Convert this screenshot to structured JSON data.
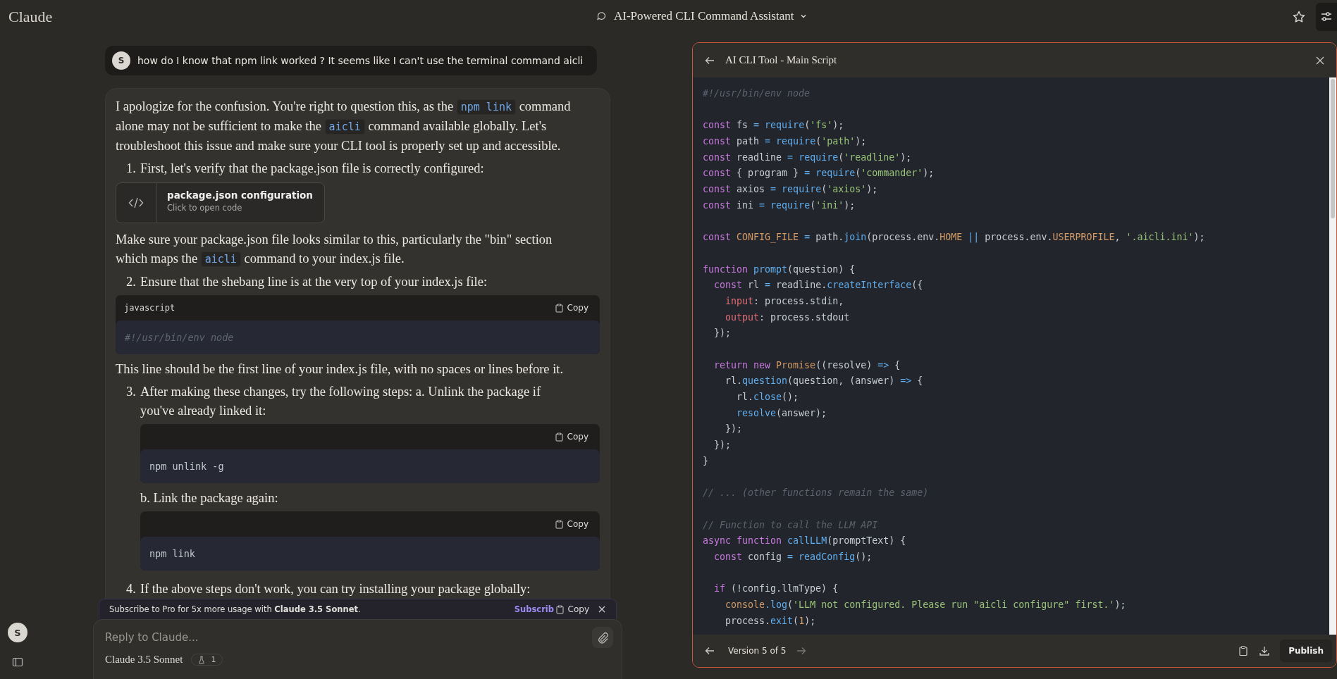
{
  "app": {
    "logo": "Claude",
    "chat_title": "AI-Powered CLI Command Assistant"
  },
  "user_message": {
    "avatar": "S",
    "text": "how do I know that npm link worked ? It seems like I can't use the terminal command aicli"
  },
  "assistant_blocks": [
    {
      "kind": "paragraph",
      "segments": [
        {
          "text": "I apologize for the confusion. You're right to question this, as the "
        },
        {
          "code": "npm link"
        },
        {
          "text": " command alone may not be sufficient to make the "
        },
        {
          "code": "aicli"
        },
        {
          "text": " command available globally. Let's troubleshoot this issue and make sure your CLI tool is properly set up and accessible."
        }
      ]
    },
    {
      "kind": "list_item",
      "number": "1.",
      "text": "First, let's verify that the package.json file is correctly configured:"
    },
    {
      "kind": "artifact_card",
      "title": "package.json configuration",
      "subtitle": "Click to open code"
    },
    {
      "kind": "paragraph",
      "segments": [
        {
          "text": "Make sure your package.json file looks similar to this, particularly the \"bin\" section which maps the "
        },
        {
          "code": "aicli"
        },
        {
          "text": " command to your index.js file."
        }
      ]
    },
    {
      "kind": "list_item",
      "number": "2.",
      "text": "Ensure that the shebang line is at the very top of your index.js file:"
    },
    {
      "kind": "code_block",
      "language": "javascript",
      "copy_label": "Copy",
      "code": "#!/usr/bin/env node",
      "comment": true
    },
    {
      "kind": "paragraph",
      "segments": [
        {
          "text": "This line should be the first line of your index.js file, with no spaces or lines before it."
        }
      ]
    },
    {
      "kind": "list_item",
      "number": "3.",
      "text": "After making these changes, try the following steps: a. Unlink the package if you've already linked it:",
      "children": [
        {
          "kind": "code_block",
          "copy_label": "Copy",
          "code": "npm unlink -g",
          "comment": false
        },
        {
          "kind": "paragraph",
          "segments": [
            {
              "text": "b. Link the package again:"
            }
          ]
        },
        {
          "kind": "code_block",
          "copy_label": "Copy",
          "code": "npm link",
          "comment": false
        }
      ]
    },
    {
      "kind": "list_item",
      "number": "4.",
      "text": "If the above steps don't work, you can try installing your package globally:"
    }
  ],
  "banner": {
    "text": "Subscribe to Pro for 5x more usage with **Claude 3.5 Sonnet**.",
    "link": "Subscrib",
    "overlay_copy": "Copy"
  },
  "composer": {
    "placeholder": "Reply to Claude...",
    "model": "Claude 3.5 Sonnet",
    "badge": "1"
  },
  "rail": {
    "avatar": "S"
  },
  "artifact": {
    "title": "AI CLI Tool - Main Script",
    "version": "Version 5 of 5",
    "publish": "Publish",
    "lines": [
      {
        "kind": "code",
        "tokens": [
          {
            "kind": "cm",
            "t": "#!/usr/bin/env node"
          }
        ]
      },
      {
        "kind": "blank"
      },
      {
        "kind": "code",
        "tokens": [
          {
            "kind": "kw",
            "t": "const "
          },
          {
            "kind": "pl",
            "t": "fs "
          },
          {
            "kind": "op",
            "t": "= "
          },
          {
            "kind": "fn",
            "t": "require"
          },
          {
            "kind": "pl",
            "t": "("
          },
          {
            "kind": "st",
            "t": "'fs'"
          },
          {
            "kind": "pl",
            "t": ");"
          }
        ]
      },
      {
        "kind": "code",
        "tokens": [
          {
            "kind": "kw",
            "t": "const "
          },
          {
            "kind": "pl",
            "t": "path "
          },
          {
            "kind": "op",
            "t": "= "
          },
          {
            "kind": "fn",
            "t": "require"
          },
          {
            "kind": "pl",
            "t": "("
          },
          {
            "kind": "st",
            "t": "'path'"
          },
          {
            "kind": "pl",
            "t": ");"
          }
        ]
      },
      {
        "kind": "code",
        "tokens": [
          {
            "kind": "kw",
            "t": "const "
          },
          {
            "kind": "pl",
            "t": "readline "
          },
          {
            "kind": "op",
            "t": "= "
          },
          {
            "kind": "fn",
            "t": "require"
          },
          {
            "kind": "pl",
            "t": "("
          },
          {
            "kind": "st",
            "t": "'readline'"
          },
          {
            "kind": "pl",
            "t": ");"
          }
        ]
      },
      {
        "kind": "code",
        "tokens": [
          {
            "kind": "kw",
            "t": "const "
          },
          {
            "kind": "pl",
            "t": "{ program } "
          },
          {
            "kind": "op",
            "t": "= "
          },
          {
            "kind": "fn",
            "t": "require"
          },
          {
            "kind": "pl",
            "t": "("
          },
          {
            "kind": "st",
            "t": "'commander'"
          },
          {
            "kind": "pl",
            "t": ");"
          }
        ]
      },
      {
        "kind": "code",
        "tokens": [
          {
            "kind": "kw",
            "t": "const "
          },
          {
            "kind": "pl",
            "t": "axios "
          },
          {
            "kind": "op",
            "t": "= "
          },
          {
            "kind": "fn",
            "t": "require"
          },
          {
            "kind": "pl",
            "t": "("
          },
          {
            "kind": "st",
            "t": "'axios'"
          },
          {
            "kind": "pl",
            "t": ");"
          }
        ]
      },
      {
        "kind": "code",
        "tokens": [
          {
            "kind": "kw",
            "t": "const "
          },
          {
            "kind": "pl",
            "t": "ini "
          },
          {
            "kind": "op",
            "t": "= "
          },
          {
            "kind": "fn",
            "t": "require"
          },
          {
            "kind": "pl",
            "t": "("
          },
          {
            "kind": "st",
            "t": "'ini'"
          },
          {
            "kind": "pl",
            "t": ");"
          }
        ]
      },
      {
        "kind": "blank"
      },
      {
        "kind": "code",
        "tokens": [
          {
            "kind": "kw",
            "t": "const "
          },
          {
            "kind": "cn",
            "t": "CONFIG_FILE "
          },
          {
            "kind": "op",
            "t": "= "
          },
          {
            "kind": "pl",
            "t": "path."
          },
          {
            "kind": "fn",
            "t": "join"
          },
          {
            "kind": "pl",
            "t": "(process.env."
          },
          {
            "kind": "cn",
            "t": "HOME "
          },
          {
            "kind": "op",
            "t": "|| "
          },
          {
            "kind": "pl",
            "t": "process.env."
          },
          {
            "kind": "cn",
            "t": "USERPROFILE"
          },
          {
            "kind": "pl",
            "t": ", "
          },
          {
            "kind": "st",
            "t": "'.aicli.ini'"
          },
          {
            "kind": "pl",
            "t": ");"
          }
        ]
      },
      {
        "kind": "blank"
      },
      {
        "kind": "code",
        "tokens": [
          {
            "kind": "kw",
            "t": "function "
          },
          {
            "kind": "fn",
            "t": "prompt"
          },
          {
            "kind": "pl",
            "t": "(question) {"
          }
        ]
      },
      {
        "kind": "code",
        "tokens": [
          {
            "kind": "kw",
            "t": "  const "
          },
          {
            "kind": "pl",
            "t": "rl "
          },
          {
            "kind": "op",
            "t": "= "
          },
          {
            "kind": "pl",
            "t": "readline."
          },
          {
            "kind": "fn",
            "t": "createInterface"
          },
          {
            "kind": "pl",
            "t": "({"
          }
        ]
      },
      {
        "kind": "code",
        "tokens": [
          {
            "kind": "pr",
            "t": "    input"
          },
          {
            "kind": "pl",
            "t": ": process.stdin,"
          }
        ]
      },
      {
        "kind": "code",
        "tokens": [
          {
            "kind": "pr",
            "t": "    output"
          },
          {
            "kind": "pl",
            "t": ": process.stdout"
          }
        ]
      },
      {
        "kind": "code",
        "tokens": [
          {
            "kind": "pl",
            "t": "  });"
          }
        ]
      },
      {
        "kind": "blank"
      },
      {
        "kind": "code",
        "tokens": [
          {
            "kind": "kw",
            "t": "  return new "
          },
          {
            "kind": "cn",
            "t": "Promise"
          },
          {
            "kind": "pl",
            "t": "((resolve) "
          },
          {
            "kind": "op",
            "t": "=> "
          },
          {
            "kind": "pl",
            "t": "{"
          }
        ]
      },
      {
        "kind": "code",
        "tokens": [
          {
            "kind": "pl",
            "t": "    rl."
          },
          {
            "kind": "fn",
            "t": "question"
          },
          {
            "kind": "pl",
            "t": "(question, (answer) "
          },
          {
            "kind": "op",
            "t": "=> "
          },
          {
            "kind": "pl",
            "t": "{"
          }
        ]
      },
      {
        "kind": "code",
        "tokens": [
          {
            "kind": "pl",
            "t": "      rl."
          },
          {
            "kind": "fn",
            "t": "close"
          },
          {
            "kind": "pl",
            "t": "();"
          }
        ]
      },
      {
        "kind": "code",
        "tokens": [
          {
            "kind": "fn",
            "t": "      resolve"
          },
          {
            "kind": "pl",
            "t": "(answer);"
          }
        ]
      },
      {
        "kind": "code",
        "tokens": [
          {
            "kind": "pl",
            "t": "    });"
          }
        ]
      },
      {
        "kind": "code",
        "tokens": [
          {
            "kind": "pl",
            "t": "  });"
          }
        ]
      },
      {
        "kind": "code",
        "tokens": [
          {
            "kind": "pl",
            "t": "}"
          }
        ]
      },
      {
        "kind": "blank"
      },
      {
        "kind": "code",
        "tokens": [
          {
            "kind": "cm",
            "t": "// ... (other functions remain the same)"
          }
        ]
      },
      {
        "kind": "blank"
      },
      {
        "kind": "code",
        "tokens": [
          {
            "kind": "cm",
            "t": "// Function to call the LLM API"
          }
        ]
      },
      {
        "kind": "code",
        "tokens": [
          {
            "kind": "kw",
            "t": "async function "
          },
          {
            "kind": "fn",
            "t": "callLLM"
          },
          {
            "kind": "pl",
            "t": "(promptText) {"
          }
        ]
      },
      {
        "kind": "code",
        "tokens": [
          {
            "kind": "kw",
            "t": "  const "
          },
          {
            "kind": "pl",
            "t": "config "
          },
          {
            "kind": "op",
            "t": "= "
          },
          {
            "kind": "fn",
            "t": "readConfig"
          },
          {
            "kind": "pl",
            "t": "();"
          }
        ]
      },
      {
        "kind": "blank"
      },
      {
        "kind": "code",
        "tokens": [
          {
            "kind": "kw",
            "t": "  if "
          },
          {
            "kind": "pl",
            "t": "(!config.llmType) {"
          }
        ]
      },
      {
        "kind": "code",
        "tokens": [
          {
            "kind": "cn",
            "t": "    console"
          },
          {
            "kind": "fn",
            "t": ".log"
          },
          {
            "kind": "pl",
            "t": "("
          },
          {
            "kind": "st",
            "t": "'LLM not configured. Please run \"aicli configure\" first.'"
          },
          {
            "kind": "pl",
            "t": ");"
          }
        ]
      },
      {
        "kind": "code",
        "tokens": [
          {
            "kind": "pl",
            "t": "    process."
          },
          {
            "kind": "fn",
            "t": "exit"
          },
          {
            "kind": "pl",
            "t": "("
          },
          {
            "kind": "cn",
            "t": "1"
          },
          {
            "kind": "pl",
            "t": ");"
          }
        ]
      }
    ]
  }
}
